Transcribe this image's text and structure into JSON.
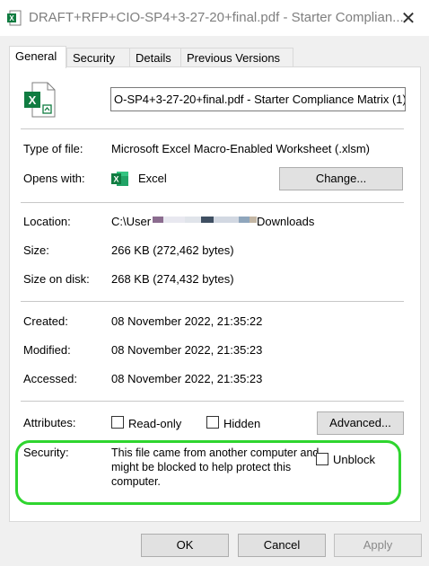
{
  "window": {
    "title": "DRAFT+RFP+CIO-SP4+3-27-20+final.pdf - Starter Complian...",
    "close_glyph": "✕"
  },
  "tabs": [
    {
      "label": "General",
      "active": true
    },
    {
      "label": "Security",
      "active": false
    },
    {
      "label": "Details",
      "active": false
    },
    {
      "label": "Previous Versions",
      "active": false
    }
  ],
  "general": {
    "file_name": "O-SP4+3-27-20+final.pdf - Starter Compliance Matrix (1)",
    "type_label": "Type of file:",
    "type_value": "Microsoft Excel Macro-Enabled Worksheet (.xlsm)",
    "opens_label": "Opens with:",
    "opens_app": "Excel",
    "change_button": "Change...",
    "location_label": "Location:",
    "location_prefix": "C:\\User",
    "location_suffix": "Downloads",
    "size_label": "Size:",
    "size_value": "266 KB (272,462 bytes)",
    "size_on_disk_label": "Size on disk:",
    "size_on_disk_value": "268 KB (274,432 bytes)",
    "created_label": "Created:",
    "created_value": "08 November 2022, 21:35:22",
    "modified_label": "Modified:",
    "modified_value": "08 November 2022, 21:35:23",
    "accessed_label": "Accessed:",
    "accessed_value": "08 November 2022, 21:35:23",
    "attributes_label": "Attributes:",
    "readonly_label": "Read-only",
    "readonly_checked": false,
    "hidden_label": "Hidden",
    "hidden_checked": false,
    "advanced_button": "Advanced...",
    "security_label": "Security:",
    "security_text": "This file came from another computer and might be blocked to help protect this computer.",
    "unblock_label": "Unblock",
    "unblock_checked": false
  },
  "footer": {
    "ok": "OK",
    "cancel": "Cancel",
    "apply": "Apply",
    "apply_enabled": false
  },
  "colors": {
    "excel_green": "#107c41",
    "highlight_ring": "#2fd52f",
    "redaction": [
      "#8b6c8f",
      "#e8e8f0",
      "#3f4f62",
      "#d2d8e2",
      "#8fa6bc",
      "#c3b6a4"
    ]
  }
}
